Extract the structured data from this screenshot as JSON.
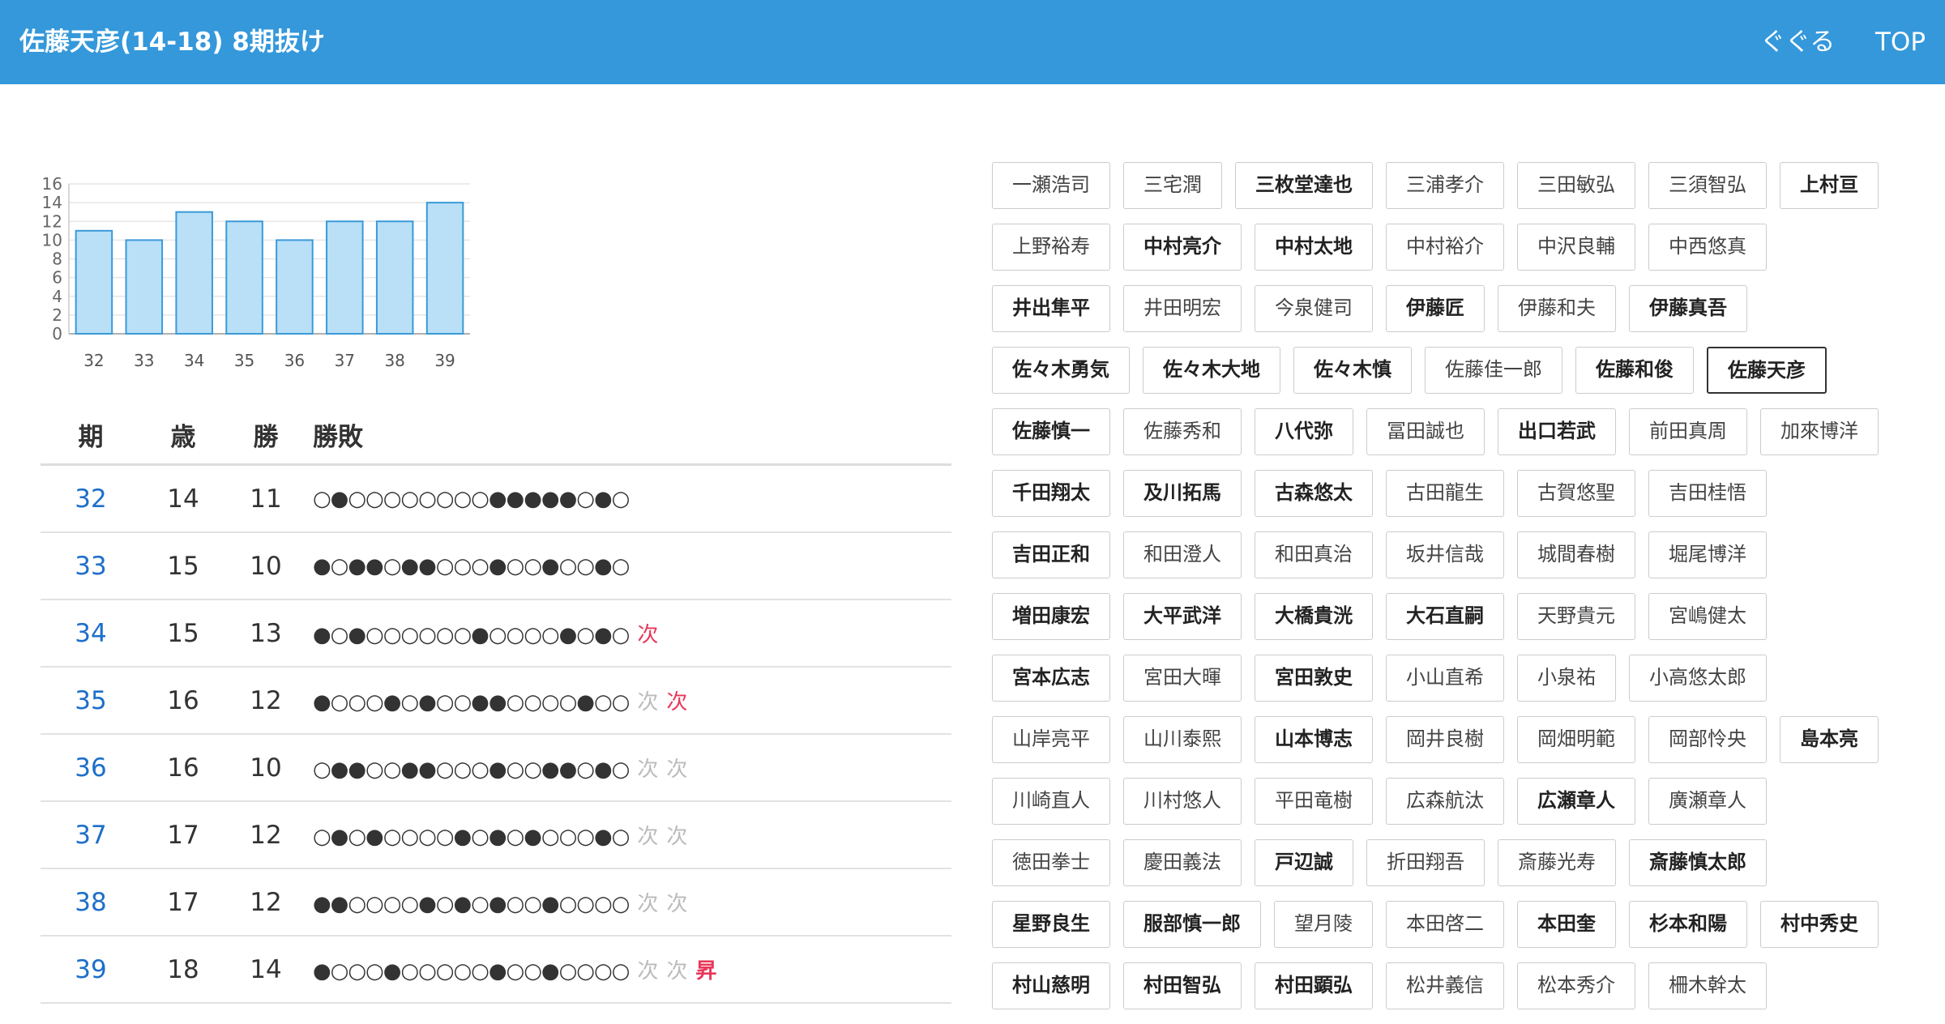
{
  "header": {
    "title": "佐藤天彦(14-18) 8期抜け",
    "nav_guguru": "ぐぐる",
    "nav_top": "TOP"
  },
  "chart_data": {
    "type": "bar",
    "categories": [
      "32",
      "33",
      "34",
      "35",
      "36",
      "37",
      "38",
      "39"
    ],
    "values": [
      11,
      10,
      13,
      12,
      10,
      12,
      12,
      14
    ],
    "yticks": [
      0,
      2,
      4,
      6,
      8,
      10,
      12,
      14,
      16
    ],
    "ylim": [
      0,
      16
    ],
    "grid": true,
    "colors": {
      "fill": "#b9e0f7",
      "stroke": "#3a9ad9",
      "grid": "#e6e6e6"
    }
  },
  "table": {
    "headers": {
      "term": "期",
      "age": "歳",
      "wins": "勝",
      "record": "勝敗"
    },
    "rows": [
      {
        "term": "32",
        "age": "14",
        "wins": "11",
        "record": "○●○○○○○○○○●●●●●○●○",
        "marks": []
      },
      {
        "term": "33",
        "age": "15",
        "wins": "10",
        "record": "●○●●○●●○○○●○○●○○●○",
        "marks": []
      },
      {
        "term": "34",
        "age": "15",
        "wins": "13",
        "record": "●○●○○○○○○●○○○○●○●○",
        "marks": [
          {
            "text": "次",
            "style": "red"
          }
        ]
      },
      {
        "term": "35",
        "age": "16",
        "wins": "12",
        "record": "●○○○●○●○○●●○○○○●○○",
        "marks": [
          {
            "text": "次",
            "style": "gray"
          },
          {
            "text": "次",
            "style": "red"
          }
        ]
      },
      {
        "term": "36",
        "age": "16",
        "wins": "10",
        "record": "○●●○○●●○○○●○○●●○●○",
        "marks": [
          {
            "text": "次",
            "style": "gray"
          },
          {
            "text": "次",
            "style": "gray"
          }
        ]
      },
      {
        "term": "37",
        "age": "17",
        "wins": "12",
        "record": "○●○●○○○○●○●○●○○○●○",
        "marks": [
          {
            "text": "次",
            "style": "gray"
          },
          {
            "text": "次",
            "style": "gray"
          }
        ]
      },
      {
        "term": "38",
        "age": "17",
        "wins": "12",
        "record": "●●○○○○●○●○●○○●○○○○",
        "marks": [
          {
            "text": "次",
            "style": "gray"
          },
          {
            "text": "次",
            "style": "gray"
          }
        ]
      },
      {
        "term": "39",
        "age": "18",
        "wins": "14",
        "record": "●○○○●○○○○○●○○●○○○○",
        "marks": [
          {
            "text": "次",
            "style": "gray"
          },
          {
            "text": "次",
            "style": "gray"
          },
          {
            "text": "昇",
            "style": "promo"
          }
        ]
      }
    ]
  },
  "names": [
    [
      {
        "n": "一瀬浩司",
        "b": false
      },
      {
        "n": "三宅潤",
        "b": false
      },
      {
        "n": "三枚堂達也",
        "b": true
      },
      {
        "n": "三浦孝介",
        "b": false
      },
      {
        "n": "三田敏弘",
        "b": false
      },
      {
        "n": "三須智弘",
        "b": false
      },
      {
        "n": "上村亘",
        "b": true
      }
    ],
    [
      {
        "n": "上野裕寿",
        "b": false
      },
      {
        "n": "中村亮介",
        "b": true
      },
      {
        "n": "中村太地",
        "b": true
      },
      {
        "n": "中村裕介",
        "b": false
      },
      {
        "n": "中沢良輔",
        "b": false
      },
      {
        "n": "中西悠真",
        "b": false
      }
    ],
    [
      {
        "n": "井出隼平",
        "b": true
      },
      {
        "n": "井田明宏",
        "b": false
      },
      {
        "n": "今泉健司",
        "b": false
      },
      {
        "n": "伊藤匠",
        "b": true
      },
      {
        "n": "伊藤和夫",
        "b": false
      },
      {
        "n": "伊藤真吾",
        "b": true
      }
    ],
    [
      {
        "n": "佐々木勇気",
        "b": true
      },
      {
        "n": "佐々木大地",
        "b": true
      },
      {
        "n": "佐々木慎",
        "b": true
      },
      {
        "n": "佐藤佳一郎",
        "b": false
      },
      {
        "n": "佐藤和俊",
        "b": true
      },
      {
        "n": "佐藤天彦",
        "b": true,
        "current": true
      }
    ],
    [
      {
        "n": "佐藤慎一",
        "b": true
      },
      {
        "n": "佐藤秀和",
        "b": false
      },
      {
        "n": "八代弥",
        "b": true
      },
      {
        "n": "冨田誠也",
        "b": false
      },
      {
        "n": "出口若武",
        "b": true
      },
      {
        "n": "前田真周",
        "b": false
      },
      {
        "n": "加來博洋",
        "b": false
      }
    ],
    [
      {
        "n": "千田翔太",
        "b": true
      },
      {
        "n": "及川拓馬",
        "b": true
      },
      {
        "n": "古森悠太",
        "b": true
      },
      {
        "n": "古田龍生",
        "b": false
      },
      {
        "n": "古賀悠聖",
        "b": false
      },
      {
        "n": "吉田桂悟",
        "b": false
      }
    ],
    [
      {
        "n": "吉田正和",
        "b": true
      },
      {
        "n": "和田澄人",
        "b": false
      },
      {
        "n": "和田真治",
        "b": false
      },
      {
        "n": "坂井信哉",
        "b": false
      },
      {
        "n": "城間春樹",
        "b": false
      },
      {
        "n": "堀尾博洋",
        "b": false
      }
    ],
    [
      {
        "n": "増田康宏",
        "b": true
      },
      {
        "n": "大平武洋",
        "b": true
      },
      {
        "n": "大橋貴洸",
        "b": true
      },
      {
        "n": "大石直嗣",
        "b": true
      },
      {
        "n": "天野貴元",
        "b": false
      },
      {
        "n": "宮嶋健太",
        "b": false
      }
    ],
    [
      {
        "n": "宮本広志",
        "b": true
      },
      {
        "n": "宮田大暉",
        "b": false
      },
      {
        "n": "宮田敦史",
        "b": true
      },
      {
        "n": "小山直希",
        "b": false
      },
      {
        "n": "小泉祐",
        "b": false
      },
      {
        "n": "小高悠太郎",
        "b": false
      }
    ],
    [
      {
        "n": "山岸亮平",
        "b": false
      },
      {
        "n": "山川泰熙",
        "b": false
      },
      {
        "n": "山本博志",
        "b": true
      },
      {
        "n": "岡井良樹",
        "b": false
      },
      {
        "n": "岡畑明範",
        "b": false
      },
      {
        "n": "岡部怜央",
        "b": false
      },
      {
        "n": "島本亮",
        "b": true
      }
    ],
    [
      {
        "n": "川崎直人",
        "b": false
      },
      {
        "n": "川村悠人",
        "b": false
      },
      {
        "n": "平田竜樹",
        "b": false
      },
      {
        "n": "広森航汰",
        "b": false
      },
      {
        "n": "広瀬章人",
        "b": true
      },
      {
        "n": "廣瀬章人",
        "b": false
      }
    ],
    [
      {
        "n": "徳田拳士",
        "b": false
      },
      {
        "n": "慶田義法",
        "b": false
      },
      {
        "n": "戸辺誠",
        "b": true
      },
      {
        "n": "折田翔吾",
        "b": false
      },
      {
        "n": "斎藤光寿",
        "b": false
      },
      {
        "n": "斎藤慎太郎",
        "b": true
      }
    ],
    [
      {
        "n": "星野良生",
        "b": true
      },
      {
        "n": "服部慎一郎",
        "b": true
      },
      {
        "n": "望月陵",
        "b": false
      },
      {
        "n": "本田啓二",
        "b": false
      },
      {
        "n": "本田奎",
        "b": true
      },
      {
        "n": "杉本和陽",
        "b": true
      },
      {
        "n": "村中秀史",
        "b": true
      }
    ],
    [
      {
        "n": "村山慈明",
        "b": true
      },
      {
        "n": "村田智弘",
        "b": true
      },
      {
        "n": "村田顕弘",
        "b": true
      },
      {
        "n": "松井義信",
        "b": false
      },
      {
        "n": "松本秀介",
        "b": false
      },
      {
        "n": "柵木幹太",
        "b": false
      }
    ]
  ]
}
